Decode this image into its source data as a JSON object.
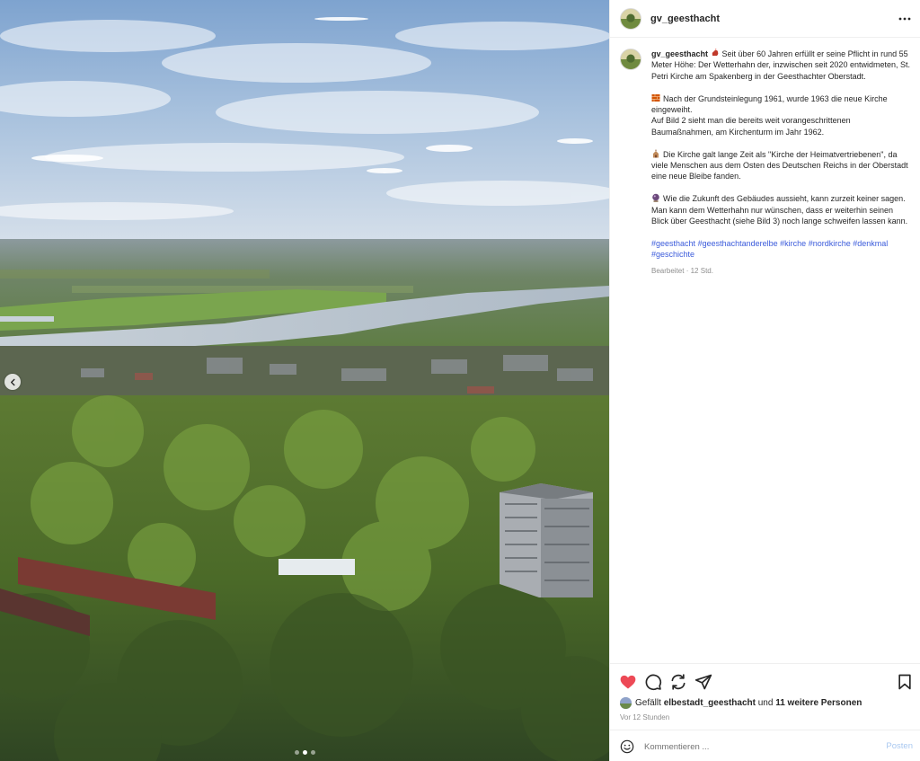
{
  "post": {
    "username": "gv_geesthacht",
    "caption": {
      "username": "gv_geesthacht",
      "p1": "Seit über 60 Jahren erfüllt er seine Pflicht in rund 55 Meter Höhe: Der Wetterhahn der, inzwischen seit 2020 entwidmeten, St. Petri Kirche am Spakenberg in der Geesthachter Oberstadt.",
      "p2a": "Nach der Grundsteinlegung 1961, wurde 1963 die neue Kirche eingeweiht.",
      "p2b": "Auf Bild 2 sieht man die bereits weit vorangeschrittenen Baumaßnahmen, am Kirchenturm im Jahr 1962.",
      "p3": "Die Kirche galt lange Zeit als \"Kirche der Heimatvertriebenen\", da viele Menschen aus dem Osten des Deutschen Reichs in der Oberstadt eine neue Bleibe fanden.",
      "p4": "Wie die Zukunft des Gebäudes aussieht, kann zurzeit keiner sagen. Man kann dem Wetterhahn nur wünschen, dass er weiterhin seinen Blick über Geesthacht (siehe Bild 3) noch lange schweifen lassen kann.",
      "hashtags": [
        "#geesthacht",
        "#geesthachtanderelbe",
        "#kirche",
        "#nordkirche",
        "#denkmal",
        "#geschichte"
      ],
      "edited_label": "Bearbeitet",
      "edited_time": "12 Std."
    },
    "likes": {
      "prefix": "Gefällt",
      "user": "elbestadt_geesthacht",
      "connector": "und",
      "others": "11 weitere Personen"
    },
    "posted_time": "Vor 12 Stunden",
    "carousel": {
      "total": 3,
      "active": 2
    }
  },
  "comment": {
    "placeholder": "Kommentieren ...",
    "post_label": "Posten"
  },
  "icons": {
    "more": "more-options-icon",
    "like": "heart-icon",
    "comment": "comment-icon",
    "share": "share-icon",
    "send": "send-icon",
    "save": "bookmark-icon",
    "emoji": "smiley-icon",
    "prev": "chevron-left-icon"
  },
  "colors": {
    "like_active": "#ed4956",
    "hashtag": "#3b5bdb",
    "post_button_disabled": "#a9c8f0"
  }
}
